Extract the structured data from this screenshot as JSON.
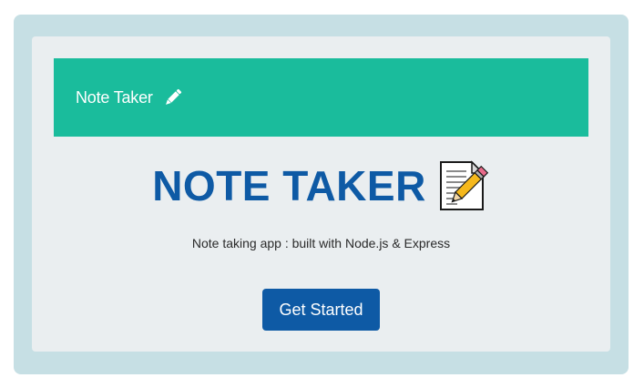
{
  "navbar": {
    "brand_label": "Note Taker",
    "brand_icon": "pencil-icon",
    "background_color": "#1abc9c"
  },
  "hero": {
    "title": "NOTE TAKER",
    "title_icon": "memo-icon",
    "title_color": "#0e5aa5",
    "subtitle": "Note taking app : built with Node.js & Express"
  },
  "cta": {
    "label": "Get Started",
    "color": "#0e5aa5"
  },
  "theme": {
    "outer_background": "#c6dfe4",
    "panel_background": "#eaeef0"
  }
}
